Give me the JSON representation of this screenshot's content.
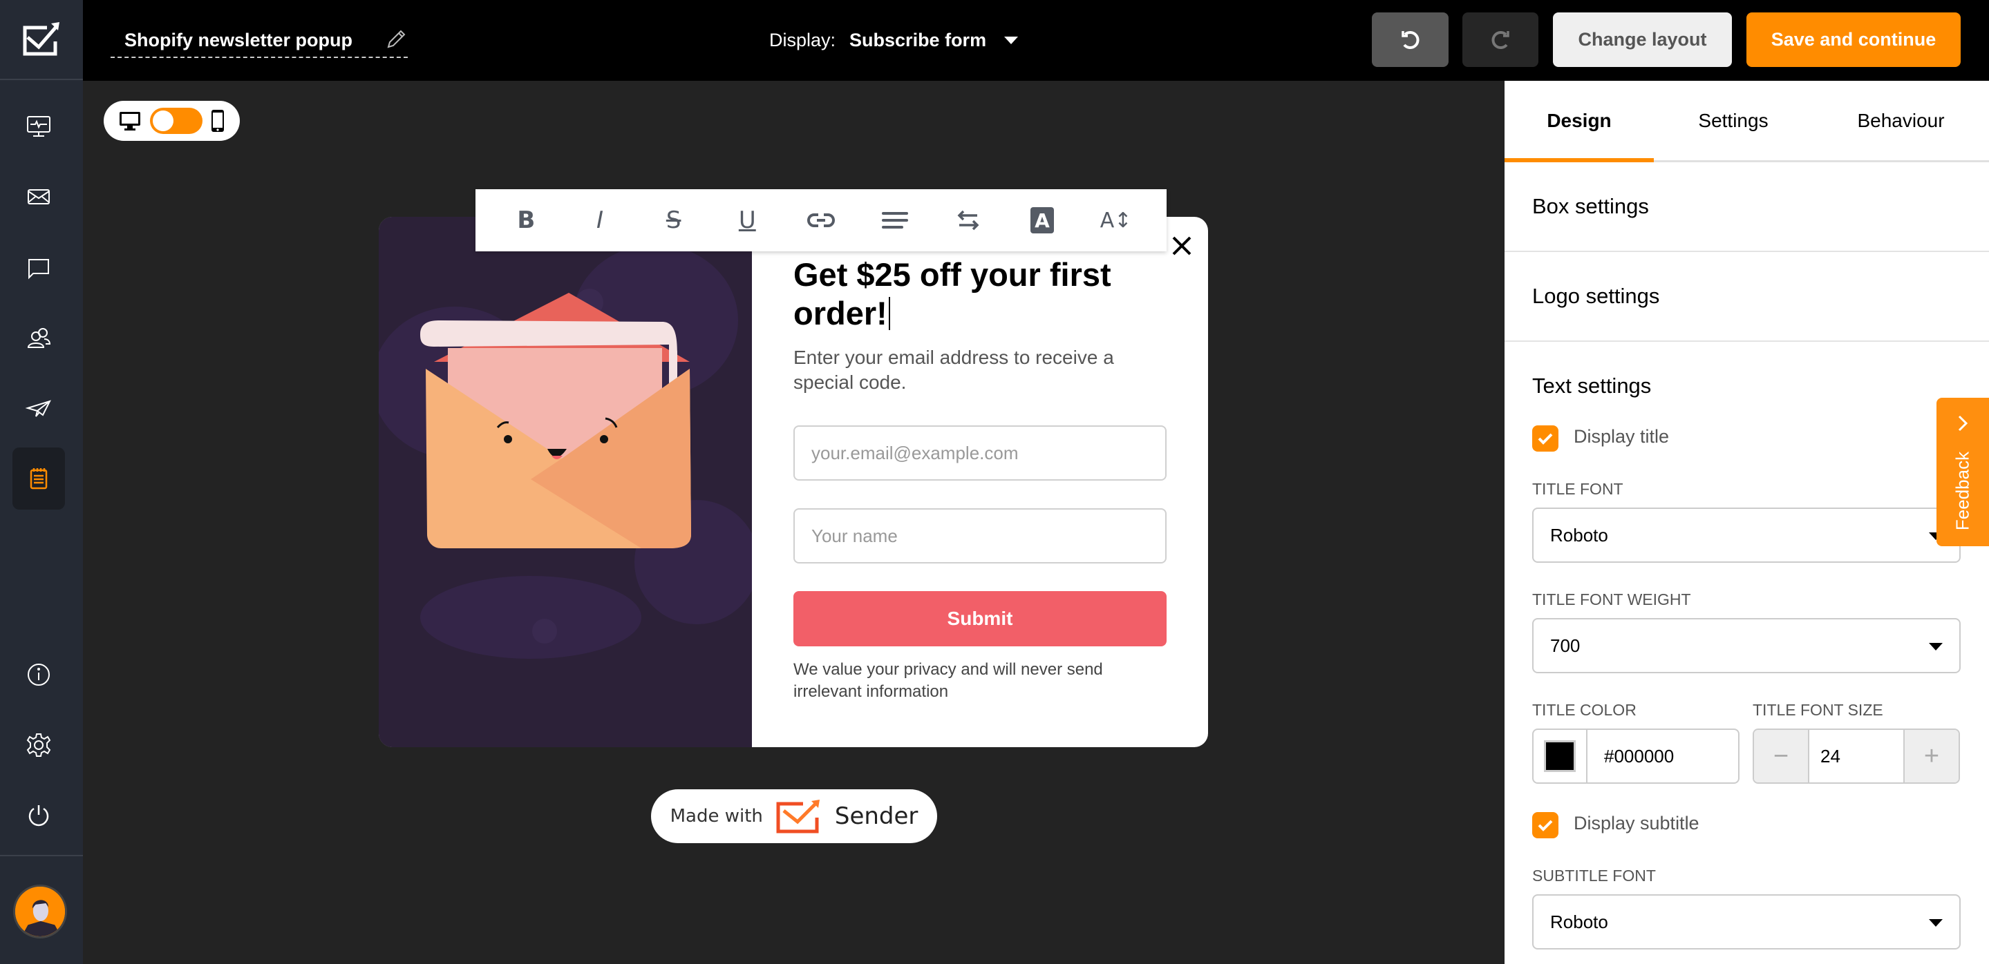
{
  "header": {
    "document_title": "Shopify newsletter popup",
    "display_label": "Display:",
    "display_value": "Subscribe form",
    "buttons": {
      "undo": "undo",
      "redo": "redo",
      "change_layout": "Change layout",
      "save_and_continue": "Save and continue"
    }
  },
  "sidebar": {
    "items": [
      {
        "name": "dashboard",
        "icon": "monitor-pulse-icon"
      },
      {
        "name": "campaigns",
        "icon": "envelope-icon"
      },
      {
        "name": "sms",
        "icon": "chat-bubble-icon"
      },
      {
        "name": "subscribers",
        "icon": "users-icon"
      },
      {
        "name": "automation",
        "icon": "paper-plane-icon"
      },
      {
        "name": "forms",
        "icon": "notepad-icon",
        "active": true
      }
    ],
    "bottom_items": [
      {
        "name": "help",
        "icon": "info-icon"
      },
      {
        "name": "settings",
        "icon": "gear-icon"
      },
      {
        "name": "logout",
        "icon": "power-icon"
      }
    ]
  },
  "canvas": {
    "device_toggle": {
      "left_icon": "desktop-icon",
      "right_icon": "mobile-icon",
      "selected": "desktop"
    },
    "toolbar": [
      "bold",
      "italic",
      "strikethrough",
      "underline",
      "link",
      "align",
      "direction",
      "text-color",
      "line-height"
    ],
    "toolbar_glyphs": [
      "B",
      "I",
      "S",
      "U",
      "⊂⊃",
      "≡",
      "⇆",
      "A",
      "A↕"
    ],
    "popup": {
      "title": "Get $25 off your first order!",
      "subtitle": "Enter your email address to receive a special code.",
      "email_placeholder": "your.email@example.com",
      "name_placeholder": "Your name",
      "submit_label": "Submit",
      "privacy_text": "We value your privacy and will never send irrelevant information"
    },
    "made_with": {
      "prefix": "Made with",
      "brand": "Sender"
    }
  },
  "panel": {
    "tabs": [
      "Design",
      "Settings",
      "Behaviour"
    ],
    "active_tab": "Design",
    "sections": {
      "box_settings": "Box settings",
      "logo_settings": "Logo settings",
      "text_settings": "Text settings"
    },
    "text_settings": {
      "display_title_label": "Display title",
      "display_title_checked": true,
      "title_font_label": "TITLE FONT",
      "title_font_value": "Roboto",
      "title_font_weight_label": "TITLE FONT WEIGHT",
      "title_font_weight_value": "700",
      "title_color_label": "TITLE COLOR",
      "title_color_value": "#000000",
      "title_font_size_label": "TITLE FONT SIZE",
      "title_font_size_value": "24",
      "display_subtitle_label": "Display subtitle",
      "display_subtitle_checked": true,
      "subtitle_font_label": "SUBTITLE FONT",
      "subtitle_font_value": "Roboto"
    }
  },
  "feedback": {
    "label": "Feedback"
  },
  "colors": {
    "accent": "#ff8c00",
    "submit": "#f25f68",
    "sidebar_bg": "#252a34",
    "canvas_bg": "#232323",
    "popup_art_bg": "#2c2138"
  }
}
